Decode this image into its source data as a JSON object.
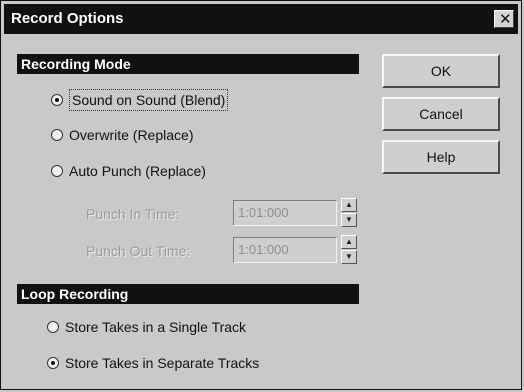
{
  "dialog": {
    "title": "Record Options",
    "close_glyph": "✕"
  },
  "recording_mode": {
    "header": "Recording Mode",
    "options": [
      {
        "label": "Sound on Sound (Blend)",
        "checked": true
      },
      {
        "label": "Overwrite (Replace)",
        "checked": false
      },
      {
        "label": "Auto Punch (Replace)",
        "checked": false
      }
    ],
    "punch_in": {
      "label": "Punch In Time:",
      "value": "1:01:000"
    },
    "punch_out": {
      "label": "Punch Out Time:",
      "value": "1:01:000"
    }
  },
  "loop_recording": {
    "header": "Loop Recording",
    "options": [
      {
        "label": "Store Takes in a Single Track",
        "checked": false
      },
      {
        "label": "Store Takes in Separate Tracks",
        "checked": true
      }
    ]
  },
  "buttons": {
    "ok": "OK",
    "cancel": "Cancel",
    "help": "Help"
  },
  "spinner_glyphs": {
    "up": "▲",
    "down": "▼"
  }
}
